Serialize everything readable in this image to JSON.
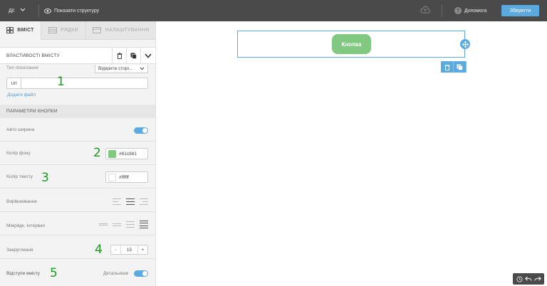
{
  "topbar": {
    "actions_label": "Дії",
    "show_structure_label": "Показати структуру",
    "help_label": "Допомога",
    "save_label": "Зберегти"
  },
  "tabs": [
    {
      "label": "ВМІСТ",
      "active": true
    },
    {
      "label": "РЯДКИ",
      "active": false
    },
    {
      "label": "НАЛАШТУВАННЯ",
      "active": false
    }
  ],
  "panel": {
    "title": "ВЛАСТИВОСТІ ВМІСТУ",
    "link_type_label": "Тип посилання",
    "link_type_value": "Відкрити сторі...",
    "url_prefix": "Url",
    "url_value": "",
    "add_file_label": "Додати файл",
    "section_title": "ПАРАМЕТРИ КНОПКИ",
    "auto_width_label": "Авто ширина",
    "bg_color_label": "Колір фону",
    "bg_color_value": "#81c881",
    "text_color_label": "Колір тексту",
    "text_color_value": "#ffffff",
    "align_label": "Вирівнювання",
    "line_height_label": "Міжрядк. інтервал",
    "radius_label": "Закруглення",
    "radius_minus": "-",
    "radius_value": "15",
    "radius_plus": "+",
    "padding_label": "Відступи вмісту",
    "detail_label": "Детальніше"
  },
  "annotations": [
    "1",
    "2",
    "3",
    "4",
    "5"
  ],
  "canvas": {
    "button_label": "Кнопка"
  },
  "colors": {
    "accent": "#5aaae0",
    "button_bg": "#81c881",
    "button_text": "#ffffff",
    "annotation": "#1a9a1a",
    "topbar": "#4a4a4a"
  }
}
